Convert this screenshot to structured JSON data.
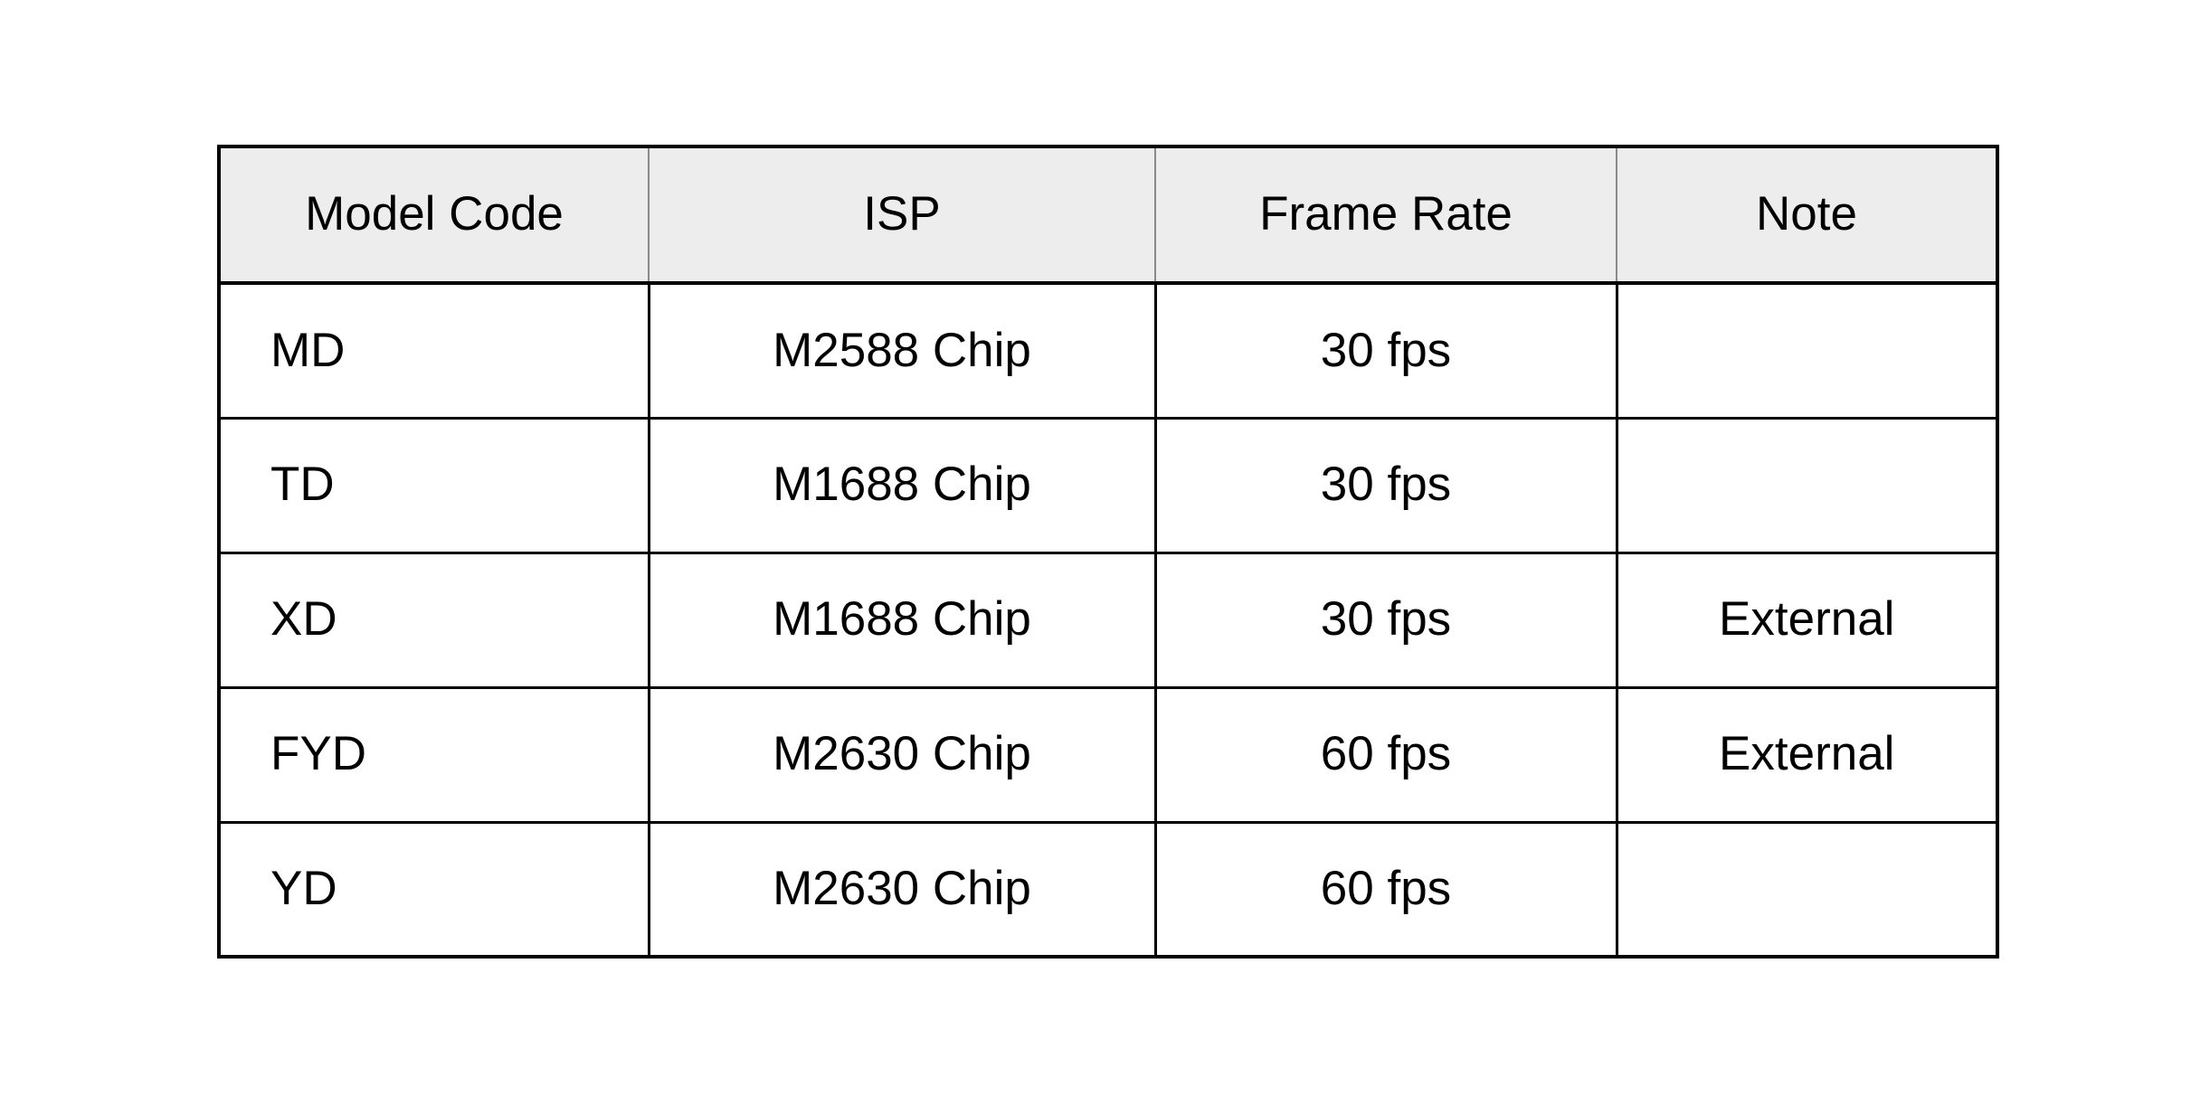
{
  "table": {
    "columns": [
      {
        "key": "model_code",
        "label": "Model Code",
        "align": "left"
      },
      {
        "key": "isp",
        "label": "ISP",
        "align": "center"
      },
      {
        "key": "frame_rate",
        "label": "Frame Rate",
        "align": "center"
      },
      {
        "key": "note",
        "label": "Note",
        "align": "center"
      }
    ],
    "headers": {
      "model_code": "Model Code",
      "isp": "ISP",
      "frame_rate": "Frame Rate",
      "note": "Note"
    },
    "rows": [
      {
        "model_code": "MD",
        "isp": "M2588 Chip",
        "frame_rate": "30 fps",
        "note": ""
      },
      {
        "model_code": "TD",
        "isp": "M1688 Chip",
        "frame_rate": "30 fps",
        "note": ""
      },
      {
        "model_code": "XD",
        "isp": "M1688 Chip",
        "frame_rate": "30 fps",
        "note": "External"
      },
      {
        "model_code": "FYD",
        "isp": "M2630 Chip",
        "frame_rate": "60 fps",
        "note": "External"
      },
      {
        "model_code": "YD",
        "isp": "M2630 Chip",
        "frame_rate": "60 fps",
        "note": ""
      }
    ],
    "style": {
      "header_background": "#ededed",
      "body_background": "#ffffff",
      "text_color": "#000000",
      "border_color": "#000000",
      "header_divider_color": "#8a8a8a",
      "page_background": "#ffffff"
    }
  }
}
